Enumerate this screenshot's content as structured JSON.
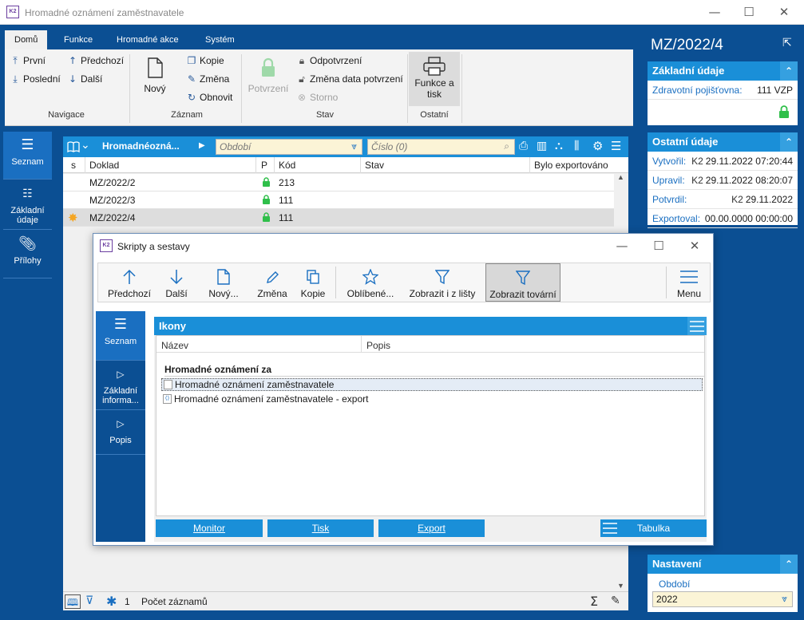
{
  "window": {
    "title": "Hromadné oznámení zaměstnavatele",
    "logo_text": "K2",
    "min_glyph": "—",
    "max_glyph": "☐",
    "close_glyph": "✕"
  },
  "ribbon": {
    "tabs": [
      "Domů",
      "Funkce",
      "Hromadné akce",
      "Systém"
    ],
    "navigace": {
      "first": "První",
      "prev": "Předchozí",
      "last": "Poslední",
      "next": "Další",
      "label": "Navigace"
    },
    "zaznam": {
      "new": "Nový",
      "copy": "Kopie",
      "edit": "Změna",
      "refresh": "Obnovit",
      "label": "Záznam"
    },
    "stav": {
      "confirm": "Potvrzení",
      "unconfirm": "Odpotvrzení",
      "change_date": "Změna data potvrzení",
      "cancel": "Storno",
      "label": "Stav"
    },
    "ostatni": {
      "funkce_line1": "Funkce a",
      "funkce_line2": "tisk",
      "label": "Ostatní"
    }
  },
  "left_nav": [
    {
      "label": "Seznam"
    },
    {
      "label_line1": "Základní",
      "label_line2": "údaje"
    },
    {
      "label": "Přílohy"
    }
  ],
  "grid": {
    "title": "Hromadnéozná...",
    "period_placeholder": "Období",
    "number_placeholder": "Číslo (0)",
    "columns": [
      "s",
      "Doklad",
      "P",
      "Kód",
      "Stav",
      "Bylo exportováno"
    ],
    "rows": [
      {
        "doklad": "MZ/2022/2",
        "kod": "213",
        "selected": false,
        "star": false
      },
      {
        "doklad": "MZ/2022/3",
        "kod": "111",
        "selected": false,
        "star": false
      },
      {
        "doklad": "MZ/2022/4",
        "kod": "111",
        "selected": true,
        "star": true
      }
    ],
    "status": {
      "count": "1",
      "label": "Počet záznamů"
    }
  },
  "right_panel": {
    "title": "MZ/2022/4",
    "zakladni": {
      "header": "Základní údaje",
      "insurer_label": "Zdravotní pojišťovna:",
      "insurer_value": "111 VZP"
    },
    "ostatni": {
      "header": "Ostatní údaje",
      "rows": [
        {
          "label": "Vytvořil:",
          "user": "K2",
          "value": "29.11.2022 07:20:44"
        },
        {
          "label": "Upravil:",
          "user": "K2",
          "value": "29.11.2022 08:20:07"
        },
        {
          "label": "Potvrdil:",
          "user": "K2",
          "value": "29.11.2022"
        },
        {
          "label": "Exportoval:",
          "user": "",
          "value": "00.00.0000 00:00:00"
        }
      ]
    },
    "nastaveni": {
      "header": "Nastavení",
      "period_label": "Období",
      "period_value": "2022"
    }
  },
  "dialog": {
    "title": "Skripty a sestavy",
    "toolbar": {
      "prev": "Předchozí",
      "next": "Další",
      "new": "Nový...",
      "edit": "Změna",
      "copy": "Kopie",
      "favorites": "Oblíbené...",
      "show_bar": "Zobrazit i z lišty",
      "show_factory": "Zobrazit tovární",
      "menu": "Menu"
    },
    "nav": [
      {
        "label": "Seznam"
      },
      {
        "label_line1": "Základní",
        "label_line2": "informa..."
      },
      {
        "label": "Popis"
      }
    ],
    "list": {
      "header": "Ikony",
      "columns": [
        "Název",
        "Popis"
      ],
      "group": "Hromadné oznámení za",
      "items": [
        {
          "name": "Hromadné oznámení zaměstnavatele",
          "selected": true
        },
        {
          "name": "Hromadné oznámení zaměstnavatele - export",
          "selected": false
        }
      ]
    },
    "buttons": {
      "monitor": "Monitor",
      "print": "Tisk",
      "export": "Export",
      "table": "Tabulka"
    }
  },
  "colors": {
    "frame_blue": "#0b4f93",
    "accent_blue": "#1a8fd8",
    "lock_green": "#2fbf4a"
  }
}
